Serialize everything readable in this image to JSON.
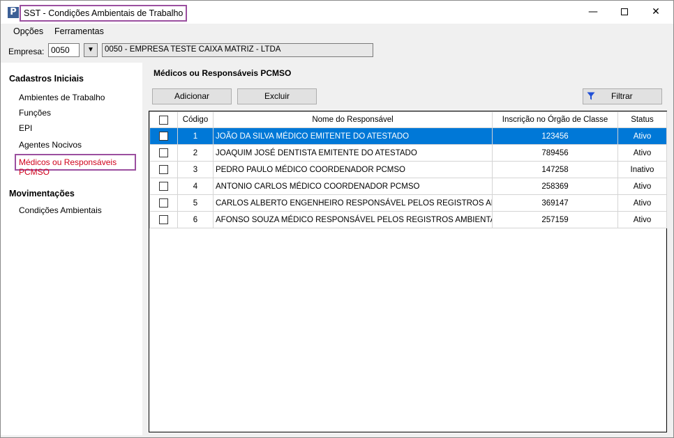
{
  "window": {
    "title": "SST - Condições Ambientais de Trabalho",
    "icon_letter": "P",
    "minimize": "—",
    "close": "✕"
  },
  "menu": [
    "Opções",
    "Ferramentas"
  ],
  "empresa": {
    "label": "Empresa:",
    "code": "0050",
    "dropdown_icon": "▼",
    "name": "0050 - EMPRESA TESTE CAIXA MATRIZ -  LTDA"
  },
  "sidebar": {
    "section1": "Cadastros Iniciais",
    "items1": [
      "Ambientes de Trabalho",
      "Funções",
      "EPI",
      "Agentes Nocivos"
    ],
    "active": "Médicos ou Responsáveis PCMSO",
    "section2": "Movimentações",
    "items2": [
      "Condições Ambientais"
    ]
  },
  "main": {
    "title": "Médicos ou Responsáveis PCMSO",
    "add_label": "Adicionar",
    "delete_label": "Excluir",
    "filter_label": "Filtrar"
  },
  "grid": {
    "columns": [
      "Código",
      "Nome do Responsável",
      "Inscrição no Órgão de Classe",
      "Status"
    ],
    "rows": [
      [
        "1",
        "JOÃO DA SILVA MÉDICO EMITENTE DO ATESTADO",
        "123456",
        "Ativo"
      ],
      [
        "2",
        "JOAQUIM JOSÉ DENTISTA EMITENTE DO ATESTADO",
        "789456",
        "Ativo"
      ],
      [
        "3",
        "PEDRO PAULO MÉDICO COORDENADOR PCMSO",
        "147258",
        "Inativo"
      ],
      [
        "4",
        "ANTONIO CARLOS MÉDICO COORDENADOR PCMSO",
        "258369",
        "Ativo"
      ],
      [
        "5",
        "CARLOS ALBERTO ENGENHEIRO RESPONSÁVEL PELOS REGISTROS AMBIENTAIS",
        "369147",
        "Ativo"
      ],
      [
        "6",
        "AFONSO SOUZA MÉDICO RESPONSÁVEL PELOS REGISTROS AMBIENTAIS",
        "257159",
        "Ativo"
      ]
    ],
    "selected_row": 0
  },
  "colors": {
    "selection": "#0078d7",
    "highlight_border": "#9b4f9f",
    "active_text": "#d0021b",
    "filter_icon": "#1f4fd6"
  }
}
